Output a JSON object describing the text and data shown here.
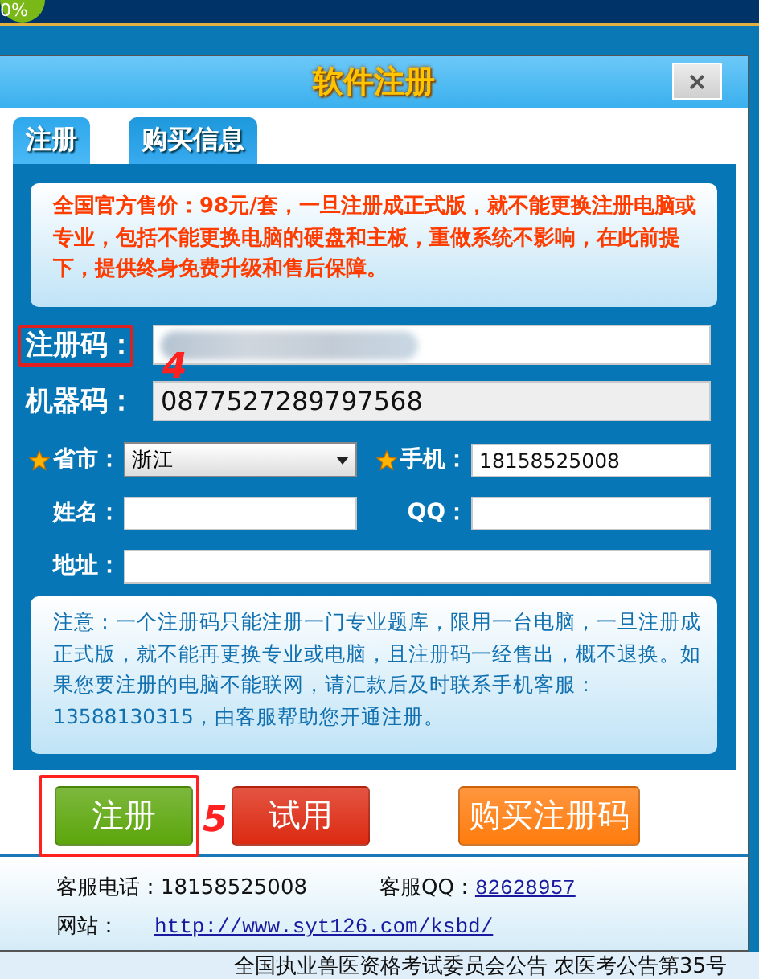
{
  "background": {
    "progress_badge": "0%",
    "bottom_notice": "全国执业兽医资格考试委员会公告 农医考公告第35号"
  },
  "window": {
    "title": "软件注册",
    "close": "×"
  },
  "tabs": [
    {
      "label": "注册",
      "selected": true
    },
    {
      "label": "购买信息",
      "selected": false
    }
  ],
  "price_notice": "全国官方售价：98元/套，一旦注册成正式版，就不能更换注册电脑或专业，包括不能更换电脑的硬盘和主板，重做系统不影响，在此前提下，提供终身免费升级和售后保障。",
  "key_rows": [
    {
      "label": "注册码：",
      "kind": "blurred",
      "highlighted": true
    },
    {
      "label": "机器码：",
      "kind": "readonly",
      "value": "0877527289797568",
      "highlighted": false
    }
  ],
  "form": [
    {
      "label": "省市：",
      "required": true,
      "kind": "select",
      "value": "浙江"
    },
    {
      "label": "手机：",
      "required": true,
      "kind": "text",
      "value": "18158525008"
    },
    {
      "label": "姓名：",
      "required": false,
      "kind": "text"
    },
    {
      "label": "QQ：",
      "required": false,
      "kind": "text"
    },
    {
      "label": "地址：",
      "required": false,
      "kind": "wide"
    }
  ],
  "notice": "注意：一个注册码只能注册一门专业题库，限用一台电脑，一旦注册成正式版，就不能再更换专业或电脑，且注册码一经售出，概不退换。如果您要注册的电脑不能联网，请汇款后及时联系手机客服：13588130315，由客服帮助您开通注册。",
  "buttons": [
    {
      "label": "注册",
      "color": "#5ca60c",
      "highlighted": true
    },
    {
      "label": "试用",
      "color": "#dc2a12",
      "highlighted": false
    },
    {
      "label": "购买注册码",
      "color": "#ff7c0e",
      "highlighted": false
    }
  ],
  "annotations": [
    {
      "label": "4"
    },
    {
      "label": "5"
    }
  ],
  "contact": {
    "phone": "客服电话：18158525008",
    "qq_label": "客服QQ：",
    "qq": "82628957",
    "site_label": "网站：",
    "site": "http://www.syt126.com/ksbd/"
  }
}
